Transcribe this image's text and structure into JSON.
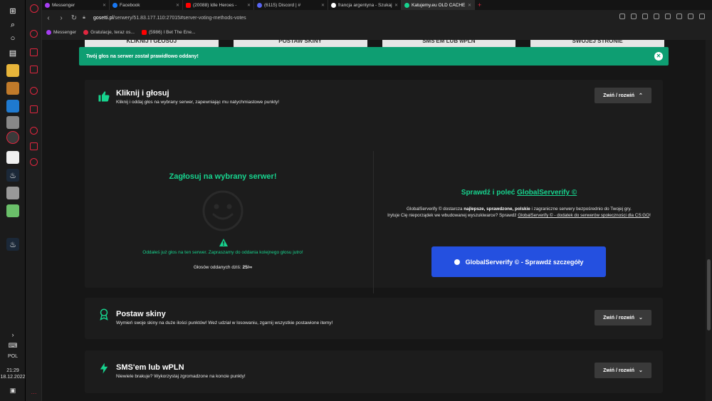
{
  "taskbar": {
    "language": "POL",
    "time": "21:29",
    "date": "18.12.2022"
  },
  "browser": {
    "tabs": [
      {
        "label": "Messenger",
        "color": "#a63df2"
      },
      {
        "label": "Facebook",
        "color": "#1877f2"
      },
      {
        "label": "(20088) Idle Heroes -",
        "color": "#ff0000"
      },
      {
        "label": "(6115) Discord | #",
        "color": "#5865f2"
      },
      {
        "label": "francja argentyna - Szukaj",
        "color": "#ffffff"
      },
      {
        "label": "Katujemy.eu OLD CACHE",
        "color": "#17d38e"
      }
    ],
    "url_domain": "gosetti.pl",
    "url_path": "/serwery/51.83.177.110:27015#server-voting-methods-votes",
    "bookmarks": [
      {
        "label": "Messenger",
        "color": "#a63df2"
      },
      {
        "label": "Gratulacje, teraz os...",
        "color": "#e0263f"
      },
      {
        "label": "(5986) I Bet The Ene...",
        "color": "#ff0000"
      }
    ]
  },
  "promos": [
    "KLIKNIJ I GŁOSUJ",
    "POSTAW SKINY",
    "SMS'EM LUB wPLN",
    "SWOJEJ STRONIE"
  ],
  "alert": {
    "message": "Twój głos na serwer został prawidłowo oddany!"
  },
  "sections": {
    "vote": {
      "title": "Kliknij i głosuj",
      "subtitle": "Kliknij i oddaj głos na wybrany serwer, zapewniając mu natychmiastowe punkty!",
      "toggle_label": "Zwiń / rozwiń",
      "heading": "Zagłosuj na wybrany serwer!",
      "message": "Oddałeś już głos na ten serwer. Zapraszamy do oddania kolejnego głosu jutro!",
      "count_label": "Głosów oddanych dziś:",
      "count_value": "25/∞"
    },
    "globalserverify": {
      "title_prefix": "Sprawdź i poleć",
      "title_link": "GlobalServerify ©",
      "text_1": "GlobalServerify © dostarcza",
      "text_bold": "najlepsze, sprawdzone, polskie",
      "text_2": "i zagraniczne serwery bezpośrednio do Twojej gry.",
      "text_3": "Irytuje Cię nieporządek we wbudowanej wyszukiwarce? Sprawdź",
      "text_link": "GlobalServerify © - dodatek do serwerów społeczności dla CS:GO",
      "button_label": "GlobalServerify © - Sprawdź szczegóły"
    },
    "skins": {
      "title": "Postaw skiny",
      "subtitle": "Wymień swoje skiny na duże ilości punktów! Weź udział w losowaniu, zgarnij wszystkie postawione itemy!",
      "toggle_label": "Zwiń / rozwiń"
    },
    "sms": {
      "title": "SMS'em lub wPLN",
      "subtitle": "Niewiele brakuje? Wykorzystaj zgromadzone na koncie punkty!",
      "toggle_label": "Zwiń / rozwiń"
    }
  },
  "colors": {
    "accent": "#17d38e",
    "alert_bg": "#0e9e72",
    "button_blue": "#2450e0"
  }
}
